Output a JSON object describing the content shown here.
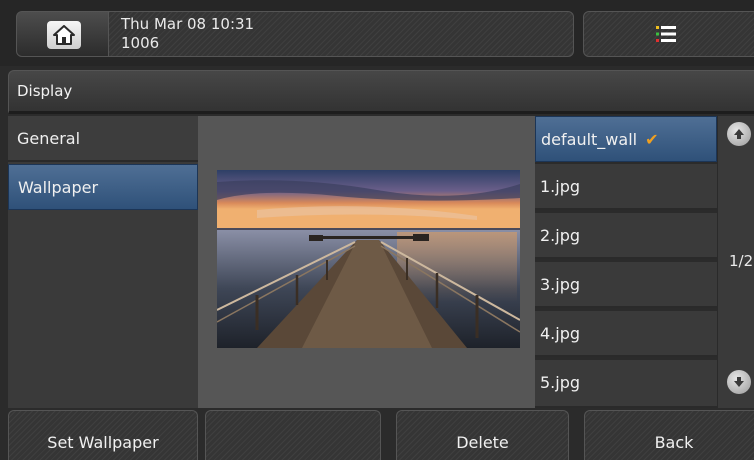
{
  "status_bar": {
    "datetime": "Thu Mar 08 10:31",
    "extension": "1006",
    "home_icon": "home-icon",
    "menu_icon": "menu-list-icon"
  },
  "title": "Display",
  "left_menu": {
    "items": [
      {
        "label": "General",
        "selected": false
      },
      {
        "label": "Wallpaper",
        "selected": true
      }
    ]
  },
  "wallpaper_list": {
    "items": [
      {
        "label": "default_wall",
        "selected": true,
        "checked": true
      },
      {
        "label": "1.jpg"
      },
      {
        "label": "2.jpg"
      },
      {
        "label": "3.jpg"
      },
      {
        "label": "4.jpg"
      },
      {
        "label": "5.jpg"
      }
    ],
    "page_indicator": "1/2"
  },
  "softkeys": [
    "Set Wallpaper",
    "",
    "Delete",
    "Back"
  ],
  "colors": {
    "selection": "#3d6189",
    "check": "#f0a020"
  }
}
